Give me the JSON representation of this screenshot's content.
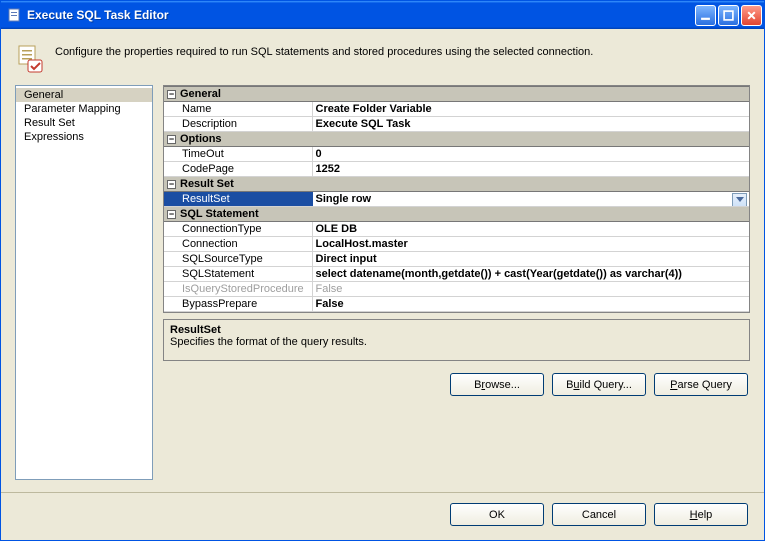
{
  "window": {
    "title": "Execute SQL Task Editor"
  },
  "header": {
    "desc": "Configure the properties required to run SQL statements and stored procedures using the selected connection."
  },
  "nav": {
    "items": [
      {
        "label": "General",
        "selected": true
      },
      {
        "label": "Parameter Mapping",
        "selected": false
      },
      {
        "label": "Result Set",
        "selected": false
      },
      {
        "label": "Expressions",
        "selected": false
      }
    ]
  },
  "grid": {
    "categories": [
      {
        "name": "General",
        "props": [
          {
            "label": "Name",
            "value": "Create Folder Variable"
          },
          {
            "label": "Description",
            "value": "Execute SQL Task"
          }
        ]
      },
      {
        "name": "Options",
        "props": [
          {
            "label": "TimeOut",
            "value": "0"
          },
          {
            "label": "CodePage",
            "value": "1252"
          }
        ]
      },
      {
        "name": "Result Set",
        "props": [
          {
            "label": "ResultSet",
            "value": "Single row",
            "selected": true,
            "dropdown": true
          }
        ]
      },
      {
        "name": "SQL Statement",
        "props": [
          {
            "label": "ConnectionType",
            "value": "OLE DB"
          },
          {
            "label": "Connection",
            "value": "LocalHost.master"
          },
          {
            "label": "SQLSourceType",
            "value": "Direct input"
          },
          {
            "label": "SQLStatement",
            "value": "select datename(month,getdate()) + cast(Year(getdate()) as varchar(4))"
          },
          {
            "label": "IsQueryStoredProcedure",
            "value": "False",
            "disabled": true
          },
          {
            "label": "BypassPrepare",
            "value": "False"
          }
        ]
      }
    ]
  },
  "desc": {
    "title": "ResultSet",
    "text": "Specifies the format of the query results."
  },
  "midButtons": {
    "browse": "Browse...",
    "build": "Build Query...",
    "parse": "Parse Query"
  },
  "footer": {
    "ok": "OK",
    "cancel": "Cancel",
    "help": "Help"
  }
}
